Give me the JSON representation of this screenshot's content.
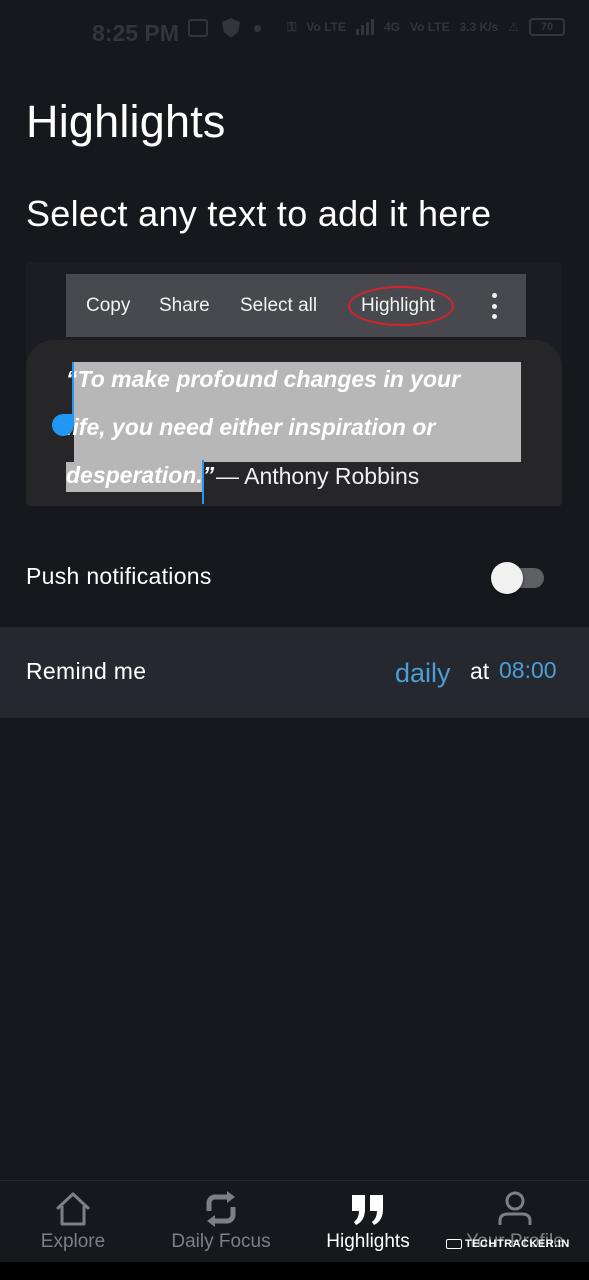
{
  "status_bar": {
    "time": "8:25 PM",
    "network_1": "Vo LTE",
    "network_2": "4G",
    "network_3": "Vo LTE",
    "speed": "3.3 K/s",
    "battery": "70"
  },
  "page": {
    "title": "Highlights",
    "subtitle": "Select any text to add it here"
  },
  "preview": {
    "menu": {
      "copy": "Copy",
      "share": "Share",
      "select_all": "Select all",
      "highlight": "Highlight"
    },
    "quote_lines": [
      "“To make profound changes in your",
      "life, you need either inspiration or",
      "desperation.”"
    ],
    "author": "— Anthony Robbins"
  },
  "settings": {
    "push_label": "Push notifications",
    "push_enabled": false,
    "remind_label": "Remind me",
    "remind_frequency": "daily",
    "remind_at": "at",
    "remind_time": "08:00"
  },
  "colors": {
    "background": "#17181d",
    "accent": "#4a9fd6",
    "remind_row": "#262830",
    "highlight_ring": "#d8222a"
  },
  "bottom_nav": {
    "items": [
      {
        "label": "Explore",
        "icon": "home-icon"
      },
      {
        "label": "Daily Focus",
        "icon": "refresh-icon"
      },
      {
        "label": "Highlights",
        "icon": "quote-icon",
        "active": true
      },
      {
        "label": "Your Profile",
        "icon": "user-icon"
      }
    ]
  },
  "watermark": "TECHTRACKER.IN"
}
